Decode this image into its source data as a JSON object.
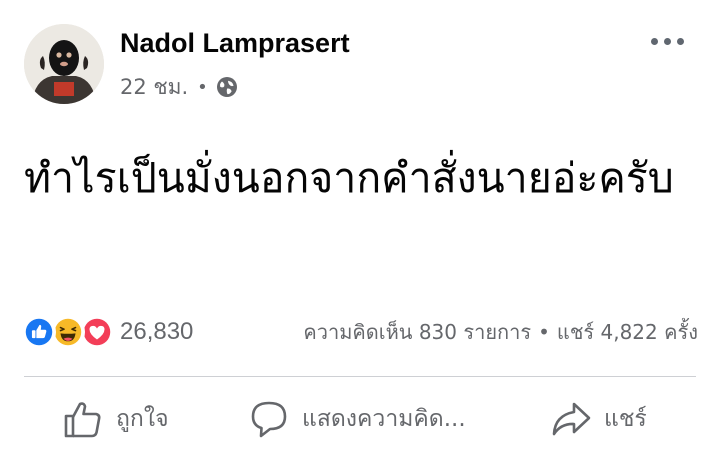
{
  "post": {
    "author": "Nadol Lamprasert",
    "timestamp": "22 ชม.",
    "meta_separator": "•",
    "audience_icon": "globe-icon",
    "more_icon": "more-horizontal-icon",
    "text": "ทำไรเป็นมั่งนอกจากคำสั่งนายอ่ะครับ"
  },
  "stats": {
    "reaction_icons": [
      "like-reaction-icon",
      "haha-reaction-icon",
      "love-reaction-icon"
    ],
    "reaction_count": "26,830",
    "comments": "ความคิดเห็น 830 รายการ",
    "separator": "•",
    "shares": "แชร์ 4,822 ครั้ง"
  },
  "actions": {
    "like_label": "ถูกใจ",
    "comment_label": "แสดงความคิด...",
    "share_label": "แชร์"
  },
  "colors": {
    "like_blue": "#1877f2",
    "haha_yellow": "#f7b928",
    "love_red": "#f33e58",
    "secondary_text": "#65676b"
  }
}
